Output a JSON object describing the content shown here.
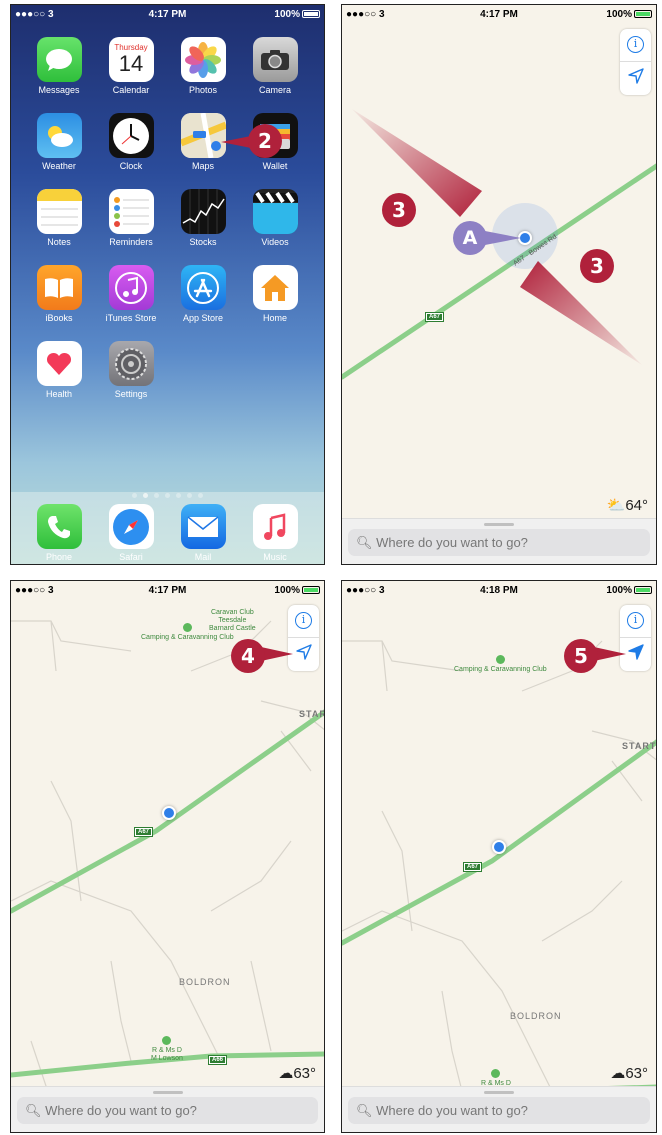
{
  "status": {
    "carrier": "●●●○○ 3",
    "battery": "100%",
    "time_1": "4:17 PM",
    "time_2": "4:17 PM",
    "time_3": "4:17 PM",
    "time_4": "4:18 PM"
  },
  "home": {
    "calendar_day": "Thursday",
    "calendar_date": "14",
    "apps": [
      "Messages",
      "Calendar",
      "Photos",
      "Camera",
      "Weather",
      "Clock",
      "Maps",
      "Wallet",
      "Notes",
      "Reminders",
      "Stocks",
      "Videos",
      "iBooks",
      "iTunes Store",
      "App Store",
      "Home",
      "Health",
      "Settings"
    ],
    "dock": [
      "Phone",
      "Safari",
      "Mail",
      "Music"
    ]
  },
  "maps": {
    "search_placeholder": "Where do you want to go?",
    "weather_2": "64°",
    "weather_3": "63°",
    "weather_4": "63°",
    "road_a67": "A67",
    "road_a66": "A66",
    "road_label": "A67 · Bowes Rd",
    "caravan": "Caravan Club\nTeesdale\nBarnard Castle",
    "camping": "Camping &\nCaravanning Club",
    "start": "START",
    "boldron": "BOLDRON",
    "lowson": "R & Ms D\nM Lowson",
    "info": "i"
  },
  "callouts": {
    "c2": "2",
    "c3": "3",
    "c4": "4",
    "c5": "5",
    "a": "A"
  },
  "colors": {
    "callout": "#b0213b",
    "callout_a": "#8d80c4",
    "road": "#8ccf8a",
    "location": "#2f7fe8"
  }
}
